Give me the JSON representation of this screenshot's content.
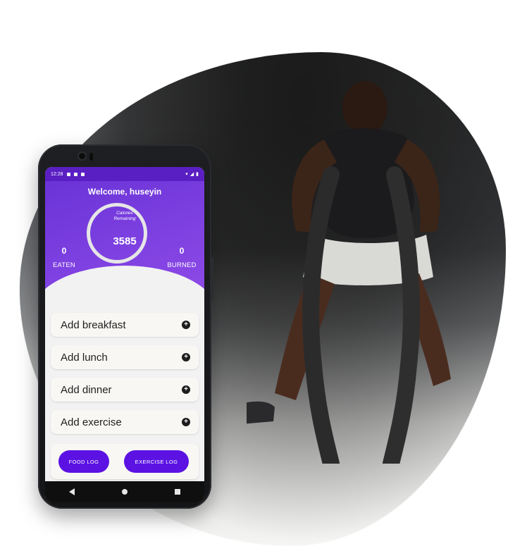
{
  "status": {
    "time": "12:28"
  },
  "header": {
    "welcome": "Welcome, huseyin",
    "ring_label_line1": "Calories",
    "ring_label_line2": "Remaining",
    "calories_remaining": "3585",
    "eaten_value": "0",
    "eaten_label": "EATEN",
    "burned_value": "0",
    "burned_label": "BURNED"
  },
  "list": [
    {
      "label": "Add breakfast"
    },
    {
      "label": "Add lunch"
    },
    {
      "label": "Add dinner"
    },
    {
      "label": "Add exercise"
    }
  ],
  "buttons": {
    "food_log": "FOOD LOG",
    "exercise_log": "EXERCISE LOG"
  },
  "icons": {
    "plus": "plus-circle-icon",
    "back": "back-icon",
    "home": "home-icon",
    "recents": "recents-icon"
  },
  "colors": {
    "primary": "#6a33d6",
    "button": "#5b12e3",
    "card": "#f8f7f4"
  }
}
